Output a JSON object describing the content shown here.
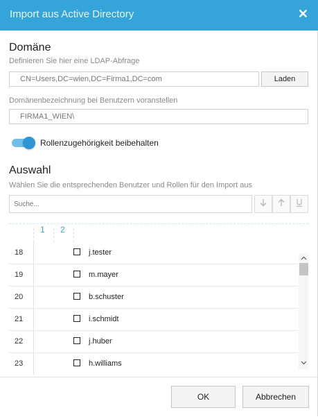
{
  "dialog": {
    "title": "Import aus Active Directory",
    "close_glyph": "✕"
  },
  "domain": {
    "heading": "Domäne",
    "ldap_label": "Definieren Sie hier eine LDAP-Abfrage",
    "ldap_value": "CN=Users,DC=wien,DC=Firma1,DC=com",
    "load_button": "Laden",
    "prefix_label": "Domänenbezeichnung bei Benutzern voranstellen",
    "prefix_value": "FIRMA1_WIEN\\"
  },
  "toggle": {
    "label": "Rollenzugehörigkeit beibehalten",
    "on": true,
    "accent": "#2c97d3"
  },
  "selection": {
    "heading": "Auswahl",
    "description": "Wählen Sie die entsprechenden Benutzer und Rollen für den Import aus",
    "search_placeholder": "Suche...",
    "icons": [
      "arrow-down-icon",
      "arrow-up-icon",
      "underline-icon"
    ],
    "column_headers": [
      "1",
      "2"
    ],
    "rows": [
      {
        "num": "18",
        "name": "j.tester",
        "checked": false
      },
      {
        "num": "19",
        "name": "m.mayer",
        "checked": false
      },
      {
        "num": "20",
        "name": "b.schuster",
        "checked": false
      },
      {
        "num": "21",
        "name": "i.schmidt",
        "checked": false
      },
      {
        "num": "22",
        "name": "j.huber",
        "checked": false
      },
      {
        "num": "23",
        "name": "h.williams",
        "checked": false
      }
    ]
  },
  "footer": {
    "ok_label": "OK",
    "cancel_label": "Abbrechen"
  },
  "colors": {
    "title_bar": "#35a5d9",
    "accent": "#35a5d9"
  }
}
